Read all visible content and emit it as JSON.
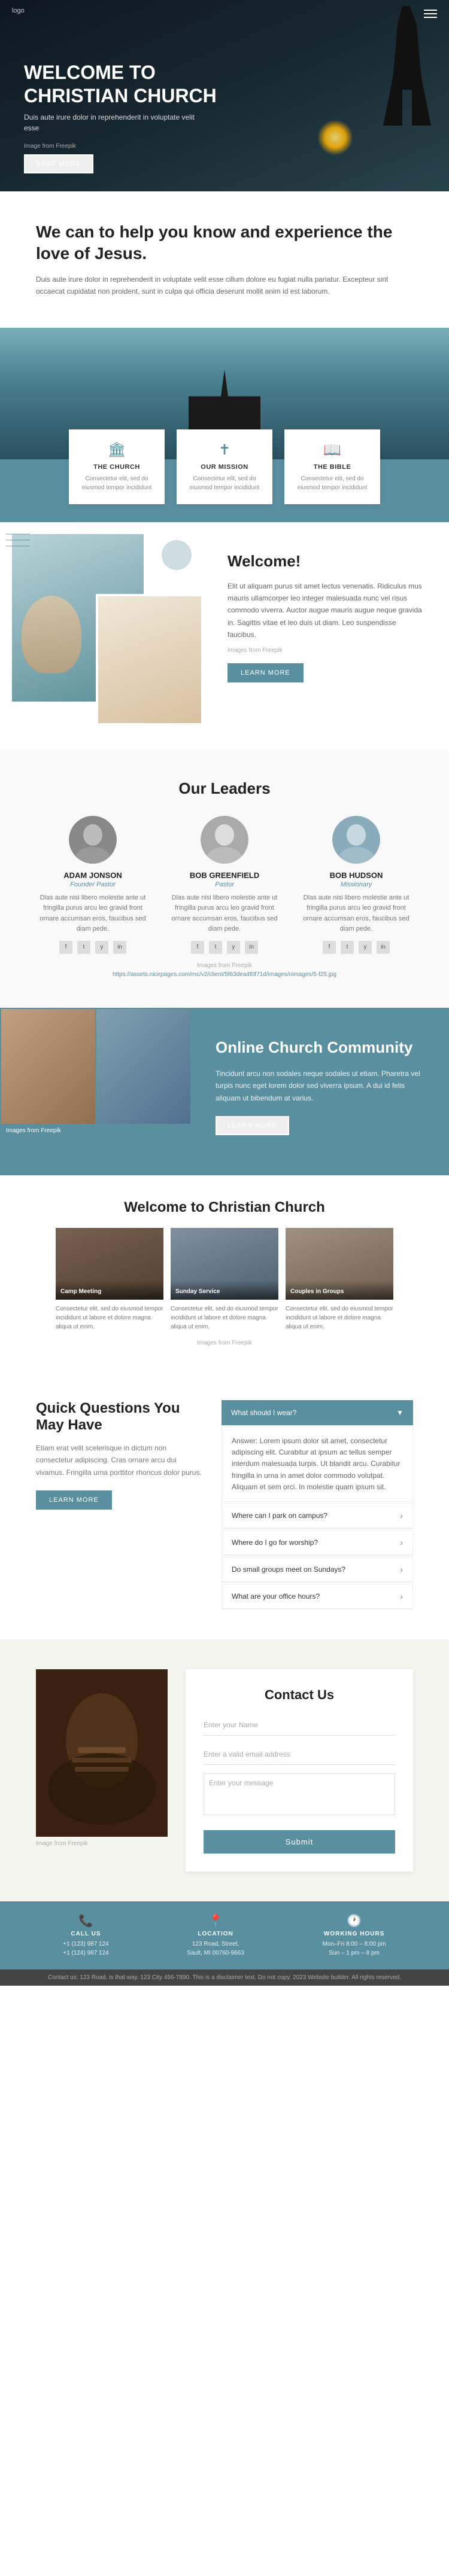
{
  "logo": "logo",
  "hero": {
    "title": "WELCOME TO\nCHRISTIAN CHURCH",
    "subtitle": "Duis aute irure dolor in reprehenderit in voluptate velit esse",
    "image_credit": "Image from Freepik",
    "read_more": "READ MORE"
  },
  "help": {
    "heading": "We can to help you know and experience the love of Jesus.",
    "body": "Duis aute irure dolor in reprehenderit in voluptate velit esse cillum dolore eu fugiat nulla pariatur. Excepteur sint occaecat cupidatat non proident, sunt in culpa qui officia deserunt mollit anim id est laborum."
  },
  "features": [
    {
      "icon": "🏛",
      "title": "THE CHURCH",
      "description": "Consectetur elit, sed do eiusmod tempor incididunt"
    },
    {
      "icon": "✝",
      "title": "OUR MISSION",
      "description": "Consectetur elit, sed do eiusmod tempor incididunt"
    },
    {
      "icon": "📖",
      "title": "THE BIBLE",
      "description": "Consectetur elit, sed do eiusmod tempor incididunt"
    }
  ],
  "welcome_section": {
    "heading": "Welcome!",
    "body1": "Elit ut aliquam purus sit amet lectus venenatis. Ridiculus mus mauris ullamcorper leo integer malesuada nunc vel risus commodo viverra. Auctor augue mauris augue neque gravida in. Sagittis vitae et leo duis ut diam. Leo suspendisse faucibus.",
    "image_credit": "Images from Freepik",
    "learn_more": "LEARN MORE"
  },
  "leaders": {
    "heading": "Our Leaders",
    "people": [
      {
        "name": "ADAM JONSON",
        "role": "Founder Pastor",
        "bio": "Dlas aute nisi libero molestie ante ut fringilla purus arcu leo gravid front ornare accumsan eros, faucibus sed diam pede."
      },
      {
        "name": "BOB GREENFIELD",
        "role": "Pastor",
        "bio": "Dlas aute nisi libero molestie ante ut fringilla purus arcu leo gravid front ornare accumsan eros, faucibus sed diam pede."
      },
      {
        "name": "BOB HUDSON",
        "role": "Missionary",
        "bio": "Dlas aute nisi libero molestie ante ut fringilla purus arcu leo gravid front ornare accumsan eros, faucibus sed diam pede."
      }
    ],
    "image_credit": "Images from Freepik",
    "image_url": "https://assets.nicepages.com/mc/v2/client/5f63dea4f0f71d/images/nimages/5-f25.jpg"
  },
  "community": {
    "heading": "Online Church Community",
    "body": "Tincidunt arcu non sodales neque sodales ut etiam. Pharetra vel turpis nunc eget lorem dolor sed viverra ipsum. A dui id felis aliquam ut bibendum at varius.",
    "image_credit": "Images from Freepik",
    "learn_more": "LEARN MORE"
  },
  "gallery": {
    "heading": "Welcome to Christian Church",
    "items": [
      {
        "label": "Camp Meeting",
        "description": "Consectetur elit, sed do eiusmod tempor incididunt ut labore et dolore magna aliqua ut enim."
      },
      {
        "label": "Sunday Service",
        "description": "Consectetur elit, sed do eiusmod tempor incididunt ut labore et dolore magna aliqua ut enim."
      },
      {
        "label": "Couples in Groups",
        "description": "Consectetur elit, sed do eiusmod tempor incididunt ut labore et dolore magna aliqua ut enim."
      }
    ],
    "image_credit": "Images from Freepik"
  },
  "questions": {
    "heading": "Quick Questions You May Have",
    "body": "Etiam erat velit scelerisque in dictum non consectetur adipiscing. Cras ornare arcu dui vivamus. Fringilla urna porttitor rhoncus dolor purus.",
    "learn_more": "LEARN MORE",
    "featured_question": "What should I wear?",
    "featured_answer": "Answer: Lorem ipsum dolor sit amet, consectetur adipiscing elit. Curabitur at ipsum ac tellus semper interdum malesuada turpis. Ut blandit arcu. Curabitur fringilla in urna in amet dolor commodo volutpat. Aliquam et sem orci. In molestie quam ipsum sit.",
    "accordion_items": [
      "Where can I park on campus?",
      "Where do I go for worship?",
      "Do small groups meet on Sundays?",
      "What are your office hours?"
    ]
  },
  "contact": {
    "heading": "Contact Us",
    "fields": {
      "name": "Enter your Name",
      "email": "Enter a valid email address",
      "message": "Enter your message"
    },
    "submit": "Submit",
    "image_credit": "Image from Freepik"
  },
  "footer": {
    "call_label": "CALL US",
    "call_value": "+1 (123) 987 124\n+1 (124) 987 124",
    "location_label": "LOCATION",
    "location_value": "123 Road, Street,\nSault, MI 00760-9663",
    "hours_label": "WORKING HOURS",
    "hours_value": "Mon–Fri 8:00 – 8:00 pm\nSun – 1 pm – 8 pm"
  },
  "bottom_strip": "Contact us: 123 Road, is that way. 123 City 456-7890. This is a disclaimer text. Do not copy. 2023 Website builder. All rights reserved."
}
